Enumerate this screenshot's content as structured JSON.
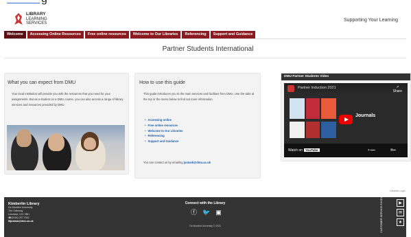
{
  "top_fragment": {
    "text": "g"
  },
  "header": {
    "logo_line1": "LIBRARY",
    "logo_line2": "LEARNING",
    "logo_line3": "SERVICES",
    "slogan": "Supporting Your Learning"
  },
  "nav": {
    "items": [
      "Welcome",
      "Accessing Online Resources",
      "Free online resources",
      "Welcome to Our Libraries",
      "Referencing",
      "Support and Guidance"
    ]
  },
  "page": {
    "title": "Partner Students International"
  },
  "box1": {
    "title": "What you can expect from DMU",
    "text": "Your local institution will provide you with the resources that you need for your assignments. But as a student on a DMU course, you can also access a range of library services and resources provided by DMU."
  },
  "box2": {
    "title": "How to use this guide",
    "text": "This guide introduces you to the main services and facilities from DMU. Use the tabs at the top or the menu below to find out more information.",
    "links": [
      "Accessing online",
      "Free online resources",
      "Welcome to Our Libraries",
      "Referencing",
      "Support and Guidance"
    ],
    "contact_prefix": "You can contact us by emailing",
    "contact_email": "justask@dmu.ac.uk"
  },
  "box3": {
    "title": "DMU Partner Students Video",
    "video_title": "Partner Induction 2021",
    "share": "Share",
    "overlay": "Journals",
    "watch_on": "Watch on",
    "youtube": "YouTube"
  },
  "library_login": "Librarian Login",
  "footer": {
    "name": "Kimberlin Library",
    "address": [
      "De Montfort University",
      "The Gateway",
      "Leicester, LE1 9BH",
      "(0116) 257 7042",
      "justask@dmu.ac.uk"
    ],
    "connect": "Connect with the Library",
    "copyright": "De Montfort University © 2022",
    "cse": "CUSTOMER SERVICE EXCELLENCE"
  },
  "colors": {
    "nav": "#8a1a1f",
    "nav_active": "#5a0d12",
    "footer": "#333333",
    "link": "#1a5ea8"
  },
  "icons": [
    "dmu-logo-icon",
    "facebook-icon",
    "twitter-icon",
    "instagram-icon",
    "play-icon",
    "share-icon",
    "youtube-icon"
  ]
}
